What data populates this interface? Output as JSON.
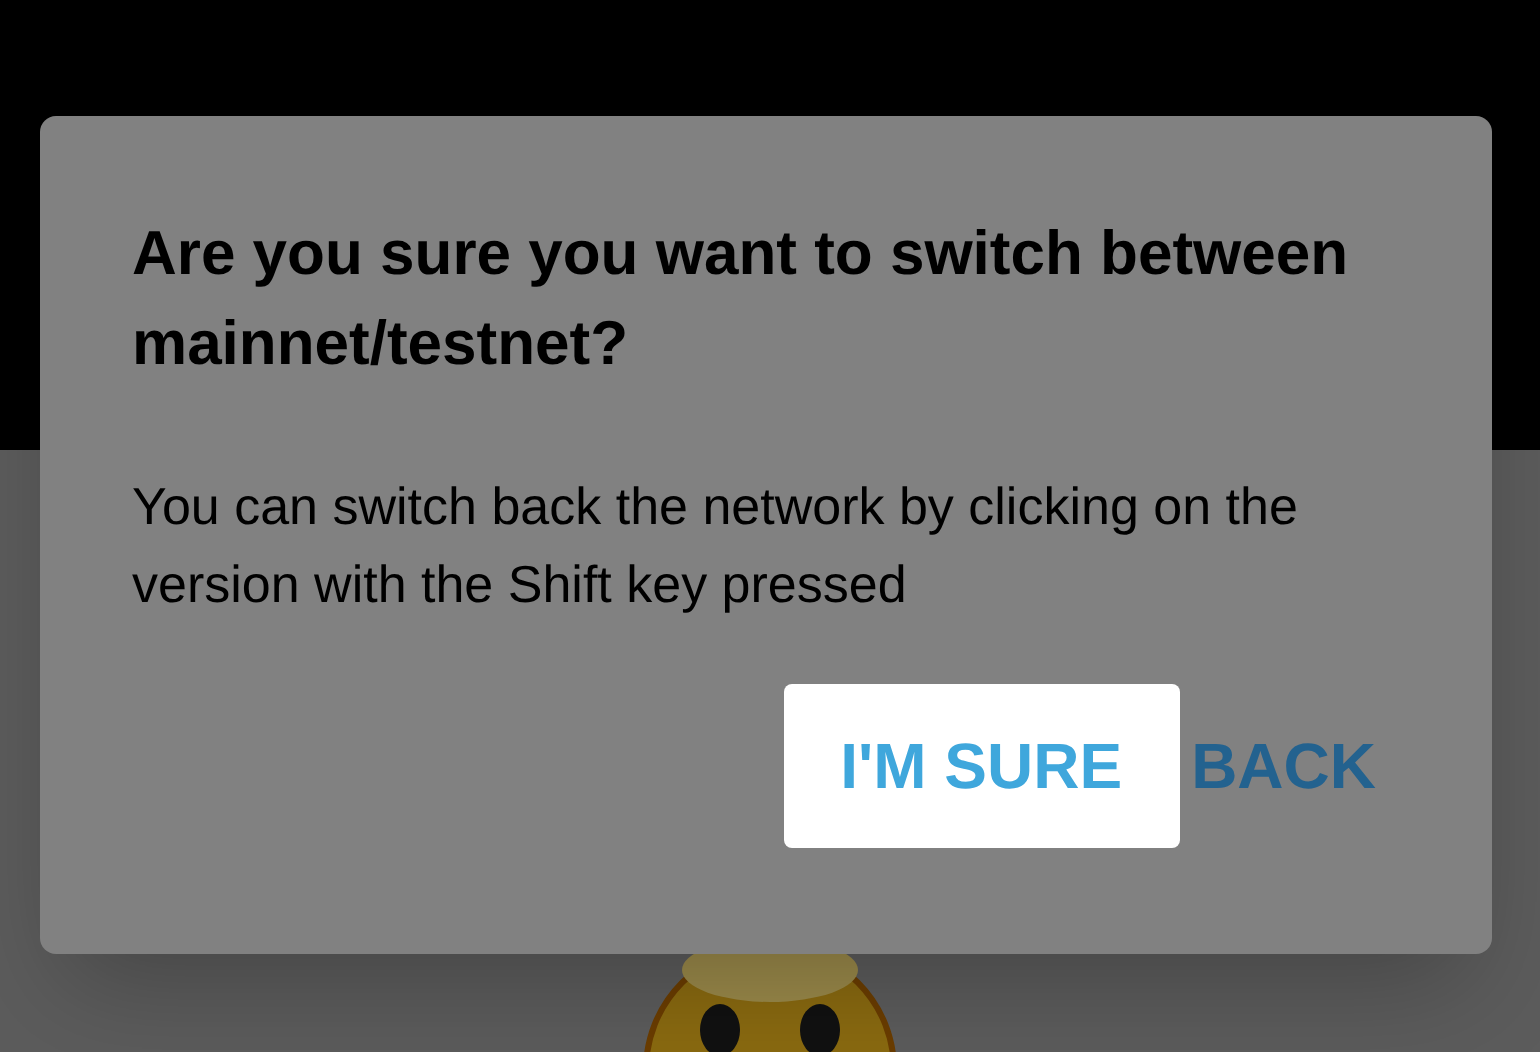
{
  "dialog": {
    "title": "Are you sure you want to switch between mainnet/testnet?",
    "message": "You can switch back the network by clicking on the version with the Shift key pressed",
    "buttons": [
      {
        "label": "I'M SURE",
        "kind": "primary"
      },
      {
        "label": "BACK",
        "kind": "text"
      }
    ]
  }
}
